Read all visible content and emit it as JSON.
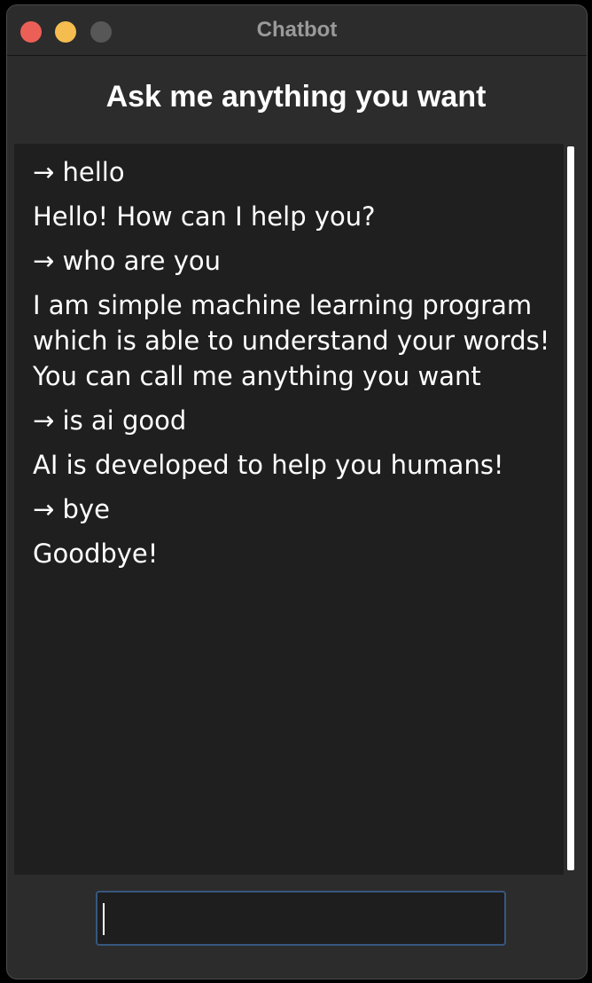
{
  "window": {
    "title": "Chatbot",
    "controls": {
      "close_color": "#ec5f57",
      "minimize_color": "#f5bd4f",
      "zoom_color": "#575757"
    }
  },
  "heading": "Ask me anything you want",
  "chat": {
    "messages": [
      {
        "role": "user",
        "text": "→ hello"
      },
      {
        "role": "bot",
        "text": "Hello! How can I help you?"
      },
      {
        "role": "user",
        "text": "→ who are you"
      },
      {
        "role": "bot",
        "text": "I am simple machine learning program which is able to understand your words! You can call me anything you want"
      },
      {
        "role": "user",
        "text": "→ is ai good"
      },
      {
        "role": "bot",
        "text": "AI is developed to help you humans!"
      },
      {
        "role": "user",
        "text": "→ bye"
      },
      {
        "role": "bot",
        "text": "Goodbye!"
      }
    ]
  },
  "input": {
    "value": "",
    "placeholder": ""
  },
  "colors": {
    "focus_border": "#37577f"
  }
}
